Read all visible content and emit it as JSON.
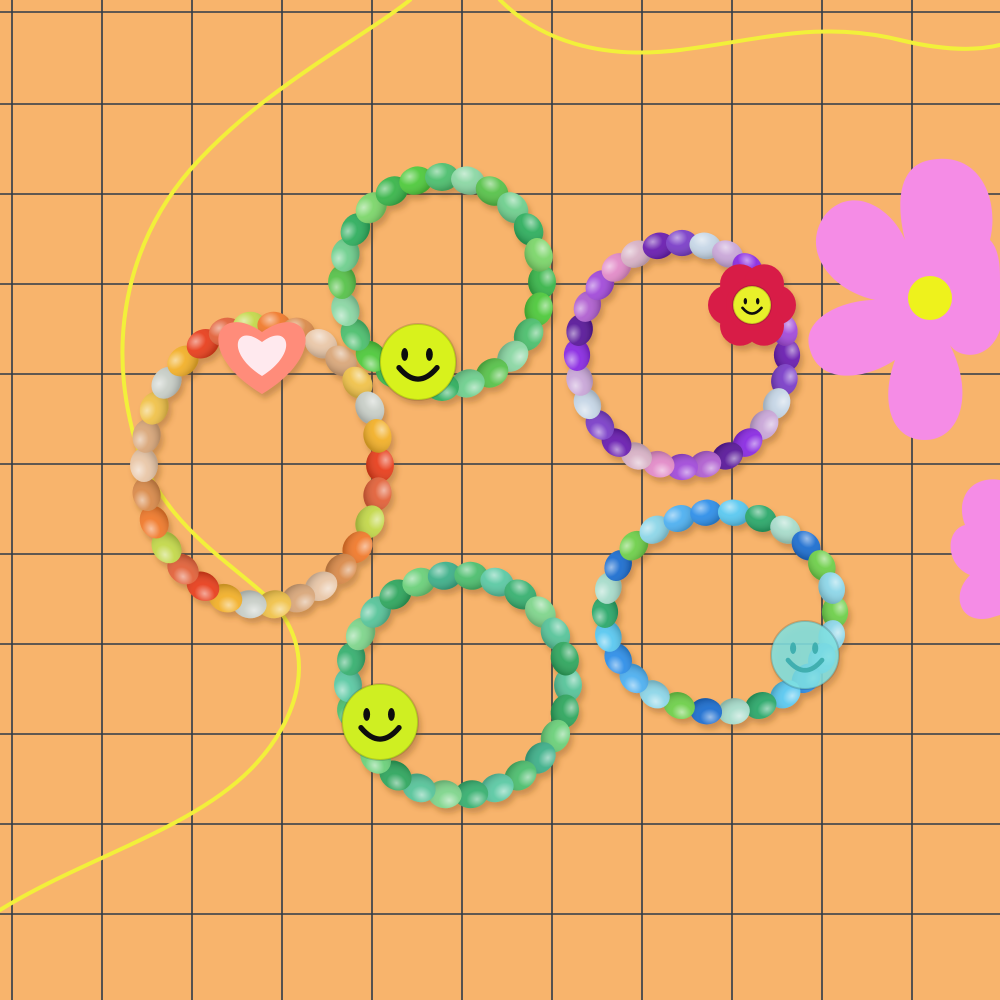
{
  "scene": {
    "background": "#F8B46C",
    "grid_color": "#2E3A48",
    "squiggle_color": "#F2F03A",
    "flower_color": "#F58CE6",
    "flower_center_color": "#EEF21C"
  },
  "rings": [
    {
      "name": "heart-rainbow-ring",
      "palette": [
        "#E8401E",
        "#F07A2C",
        "#D9A77A",
        "#F2B02A",
        "#C3D84A",
        "#E9C7A8",
        "#C9CFC8",
        "#E2623A",
        "#D98A4A",
        "#F0C24A"
      ],
      "charm": "heart",
      "charm_color": "#FF8C7A",
      "charm_inner_color": "#FFE9EE"
    },
    {
      "name": "green-smiley-ring-top",
      "palette": [
        "#4FC93C",
        "#39B54A",
        "#7CD66A",
        "#2FAE5E",
        "#6FCF8E",
        "#58C24A",
        "#8BD7A4",
        "#4DBF6E"
      ],
      "charm": "smiley",
      "charm_color": "#D8F21A"
    },
    {
      "name": "purple-flower-ring",
      "palette": [
        "#8A2BE2",
        "#A24BD9",
        "#6A1FB0",
        "#C9A7D8",
        "#B05FD0",
        "#D8B2C6",
        "#C6D6E6",
        "#5A1A9A",
        "#E28BC8",
        "#7B3FC8"
      ],
      "charm": "flower-smiley",
      "charm_color": "#D81E46",
      "charm_inner_color": "#E8F02A"
    },
    {
      "name": "blue-smiley-ring",
      "palette": [
        "#2F8FE8",
        "#4FB0F0",
        "#8DD6E8",
        "#6ECF4A",
        "#1F6FD0",
        "#A8DCCB",
        "#2BA86A",
        "#5AC8F0"
      ],
      "charm": "smiley-clear",
      "charm_color": "#7FE0E0"
    },
    {
      "name": "green-smiley-ring-bottom",
      "palette": [
        "#4DBE6E",
        "#3FB08A",
        "#6BD07A",
        "#2FA65E",
        "#58C49A",
        "#7FD58C",
        "#38B070",
        "#5CC9A4"
      ],
      "charm": "smiley",
      "charm_color": "#CFEF20"
    }
  ]
}
